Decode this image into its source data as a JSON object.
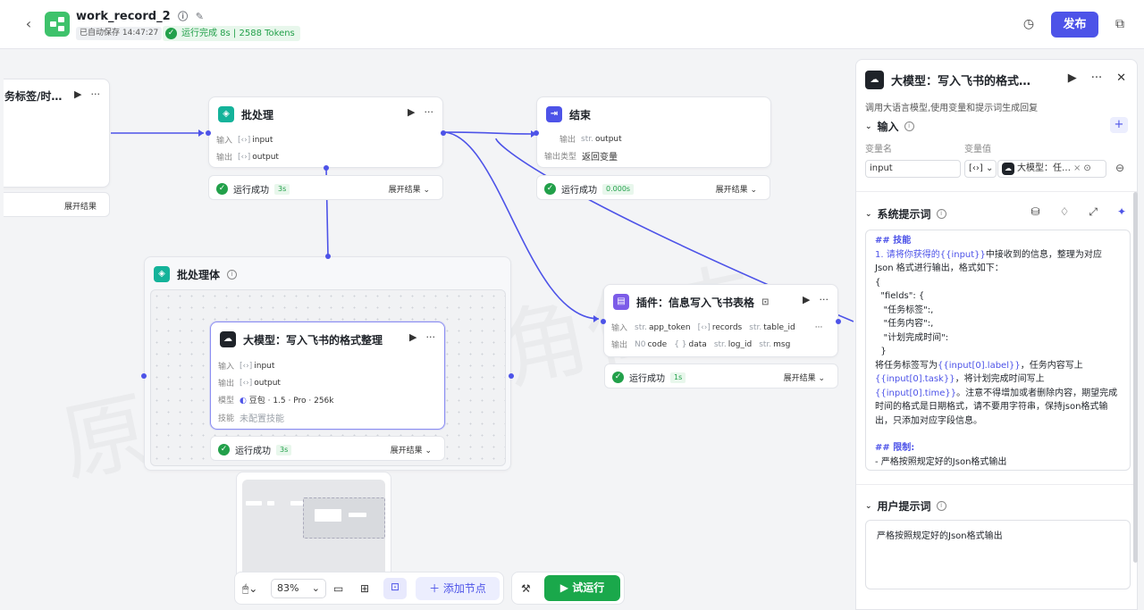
{
  "header": {
    "back_icon": "chevron-left-icon",
    "title": "work_record_2",
    "autosave": "已自动保存 14:47:27",
    "run_status": "运行完成 8s | 2588 Tokens",
    "publish_label": "发布"
  },
  "nodes": {
    "left_partial": {
      "title": "务标签/时…",
      "expand": "展开结果"
    },
    "batch": {
      "title": "批处理",
      "input_label": "输入",
      "input_value": "input",
      "output_label": "输出",
      "output_value": "output",
      "status": "运行成功",
      "time": "3s",
      "expand": "展开结果"
    },
    "end": {
      "title": "结束",
      "output_label": "输出",
      "output_value": "output",
      "output_type_label": "输出类型",
      "output_type_value": "返回变量",
      "status": "运行成功",
      "time": "0.000s",
      "expand": "展开结果"
    },
    "batch_body": {
      "title": "批处理体"
    },
    "llm": {
      "title": "大模型：写入飞书的格式整理",
      "input_label": "输入",
      "input_value": "input",
      "output_label": "输出",
      "output_value": "output",
      "model_label": "模型",
      "model_value": "豆包 · 1.5 · Pro · 256k",
      "skill_label": "技能",
      "skill_value": "未配置技能",
      "status": "运行成功",
      "time": "3s",
      "expand": "展开结果"
    },
    "plugin": {
      "title": "插件：信息写入飞书表格",
      "input_label": "输入",
      "inputs": [
        {
          "type": "str.",
          "name": "app_token"
        },
        {
          "type": "[‹›]",
          "name": "records"
        },
        {
          "type": "str.",
          "name": "table_id"
        }
      ],
      "more": "···",
      "output_label": "输出",
      "outputs": [
        {
          "type": "N0",
          "name": "code"
        },
        {
          "type": "{ }",
          "name": "data"
        },
        {
          "type": "str.",
          "name": "log_id"
        },
        {
          "type": "str.",
          "name": "msg"
        }
      ],
      "status": "运行成功",
      "time": "1s",
      "expand": "展开结果"
    }
  },
  "toolbar": {
    "zoom": "83%",
    "add_node": "添加节点",
    "test_run": "试运行"
  },
  "panel": {
    "title": "大模型：写入飞书的格式…",
    "description": "调用大语言模型,使用变量和提示词生成回复",
    "input_section": "输入",
    "var_name_label": "变量名",
    "var_value_label": "变量值",
    "var_name": "input",
    "var_type": "[‹›]",
    "var_ref": "大模型：任…",
    "system_prompt_section": "系统提示词",
    "system_prompt": {
      "heading1": "## 技能",
      "l1a": "1. 请将你获得的",
      "l1b": "{{input}}",
      "l1c": "中接收到的信息，整理为对应 Json 格式进行输出，格式如下：",
      "l2": "{",
      "l3": "  \"fields\": {",
      "l4": "   \"任务标签\":,",
      "l5": "   \"任务内容\":,",
      "l6": "   \"计划完成时间\":",
      "l7": "  }",
      "l8a": "将任务标签写为",
      "l8b": "{{input[0].label}}",
      "l8c": "，任务内容写上",
      "l8d": "{{input[0].task}}",
      "l8e": "，将计划完成时间写上",
      "l8f": "{{input[0].time}}",
      "l8g": "。注意不得增加或者删除内容，期望完成时间的格式是日期格式，请不要用字符串，保持json格式输出，只添加对应字段信息。",
      "heading2": "## 限制:",
      "l9": "- 严格按照规定好的Json格式输出"
    },
    "user_prompt_section": "用户提示词",
    "user_prompt": "严格按照规定好的Json格式输出"
  },
  "colors": {
    "accent": "#4d53e8",
    "success": "#22a04a",
    "teal": "#14b39a"
  }
}
